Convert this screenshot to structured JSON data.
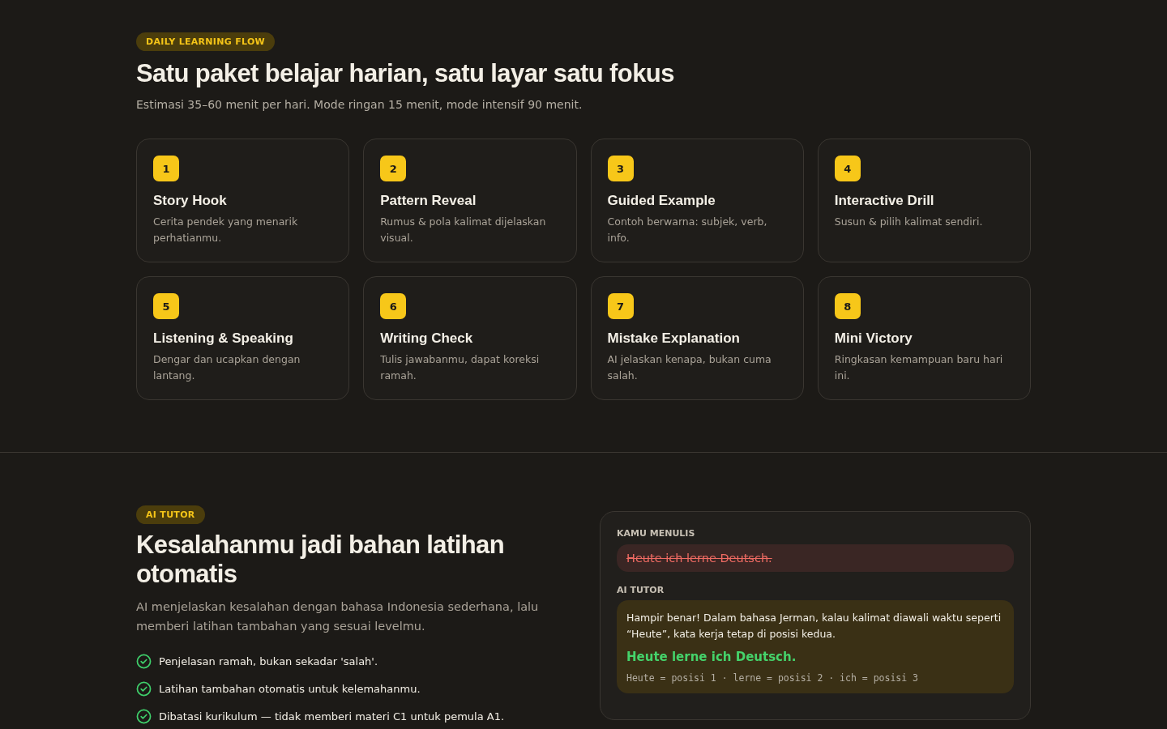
{
  "flow": {
    "badge": "DAILY LEARNING FLOW",
    "title": "Satu paket belajar harian, satu layar satu fokus",
    "subtitle": "Estimasi 35–60 menit per hari. Mode ringan 15 menit, mode intensif 90 menit.",
    "steps": [
      {
        "number": "1",
        "title": "Story Hook",
        "text": "Cerita pendek yang menarik perhatianmu."
      },
      {
        "number": "2",
        "title": "Pattern Reveal",
        "text": "Rumus & pola kalimat dijelaskan visual."
      },
      {
        "number": "3",
        "title": "Guided Example",
        "text": "Contoh berwarna: subjek, verb, info."
      },
      {
        "number": "4",
        "title": "Interactive Drill",
        "text": "Susun & pilih kalimat sendiri."
      },
      {
        "number": "5",
        "title": "Listening & Speaking",
        "text": "Dengar dan ucapkan dengan lantang."
      },
      {
        "number": "6",
        "title": "Writing Check",
        "text": "Tulis jawabanmu, dapat koreksi ramah."
      },
      {
        "number": "7",
        "title": "Mistake Explanation",
        "text": "AI jelaskan kenapa, bukan cuma salah."
      },
      {
        "number": "8",
        "title": "Mini Victory",
        "text": "Ringkasan kemampuan baru hari ini."
      }
    ]
  },
  "tutor": {
    "badge": "AI TUTOR",
    "title": "Kesalahanmu jadi bahan latihan otomatis",
    "text": "AI menjelaskan kesalahan dengan bahasa Indonesia sederhana, lalu memberi latihan tambahan yang sesuai levelmu.",
    "features": [
      "Penjelasan ramah, bukan sekadar 'salah'.",
      "Latihan tambahan otomatis untuk kelemahanmu.",
      "Dibatasi kurikulum — tidak memberi materi C1 untuk pemula A1."
    ],
    "example": {
      "user_label": "KAMU MENULIS",
      "user_sentence": "Heute ich lerne Deutsch.",
      "tutor_label": "AI TUTOR",
      "explanation": "Hampir benar! Dalam bahasa Jerman, kalau kalimat diawali waktu seperti “Heute”, kata kerja tetap di posisi kedua.",
      "correction": "Heute lerne ich Deutsch.",
      "breakdown": "Heute = posisi 1 · lerne = posisi 2 · ich = posisi 3"
    }
  }
}
